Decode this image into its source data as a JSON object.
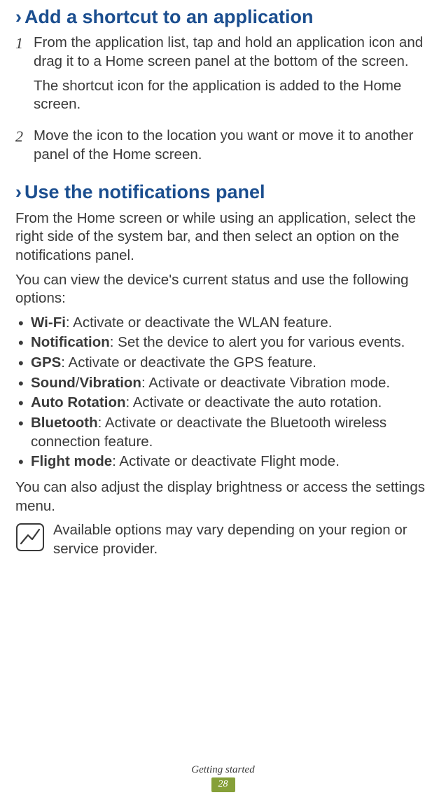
{
  "heading1_prefix": "›",
  "heading1_text": "Add a shortcut to an application",
  "step1_num": "1",
  "step1_p1": "From the application list, tap and hold an application icon and drag it to a Home screen panel at the bottom of the screen.",
  "step1_p2": "The shortcut icon for the application is added to the Home screen.",
  "step2_num": "2",
  "step2_p1": "Move the icon to the location you want or move it to another panel of the Home screen.",
  "heading2_prefix": "›",
  "heading2_text": "Use the notifications panel",
  "para1": "From the Home screen or while using an application, select the right side of the system bar, and then select an option on the notifications panel.",
  "para2": "You can view the device's current status and use the following options:",
  "bullets": [
    {
      "b": "Wi-Fi",
      "t": ": Activate or deactivate the WLAN feature."
    },
    {
      "b": "Notification",
      "t": ": Set the device to alert you for various events."
    },
    {
      "b": "GPS",
      "t": ": Activate or deactivate the GPS feature."
    },
    {
      "b": "Sound",
      "mid": "/",
      "b2": "Vibration",
      "t": ": Activate or deactivate Vibration mode."
    },
    {
      "b": "Auto Rotation",
      "t": ": Activate or deactivate the auto rotation."
    },
    {
      "b": "Bluetooth",
      "t": ": Activate or deactivate the Bluetooth wireless connection feature."
    },
    {
      "b": "Flight mode",
      "t": ": Activate or deactivate Flight mode."
    }
  ],
  "para3": "You can also adjust the display brightness or access the settings menu.",
  "note_text": "Available options may vary depending on your region or service provider.",
  "footer_label": "Getting started",
  "footer_page": "28"
}
